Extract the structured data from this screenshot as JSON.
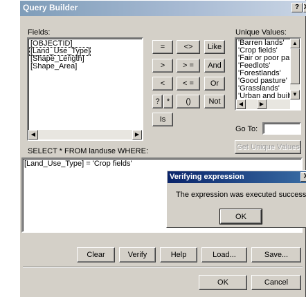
{
  "window": {
    "title": "Query Builder",
    "help_button": "?",
    "close_button": "X"
  },
  "fields": {
    "label": "Fields:",
    "items": [
      "[OBJECTID]",
      "[Land_Use_Type]",
      "[Shape_Length]",
      "[Shape_Area]"
    ],
    "selected_index": 1
  },
  "operators": {
    "equals": "=",
    "not_equal": "<>",
    "like": "Like",
    "greater": ">",
    "greater_equal": "> =",
    "and": "And",
    "less": "<",
    "less_equal": "< =",
    "or": "Or",
    "single_wildcard": "?",
    "multi_wildcard": "*",
    "parentheses": "()",
    "not": "Not",
    "is": "Is"
  },
  "unique_values": {
    "label": "Unique Values:",
    "items": [
      "'Barren lands'",
      "'Crop fields'",
      "'Fair or poor pastu",
      "'Feedlots'",
      "'Forestlands'",
      "'Good pasture'",
      "'Grasslands'",
      "'Urban and built-"
    ],
    "goto_label": "Go To:",
    "goto_value": "",
    "get_button": "Get Unique Values"
  },
  "query": {
    "label": "SELECT * FROM landuse WHERE:",
    "expression": "[Land_Use_Type] = 'Crop fields'"
  },
  "message": {
    "title": "Verifying expression",
    "close": "X",
    "text": "The expression was executed successfully",
    "ok": "OK"
  },
  "actions": {
    "clear": "Clear",
    "verify": "Verify",
    "help": "Help",
    "load": "Load...",
    "save": "Save..."
  },
  "footer": {
    "ok": "OK",
    "cancel": "Cancel"
  },
  "colors": {
    "dialog_face": "#d4d0c8",
    "active_title": "#0a246a",
    "inactive_title": "#7f9db9"
  }
}
